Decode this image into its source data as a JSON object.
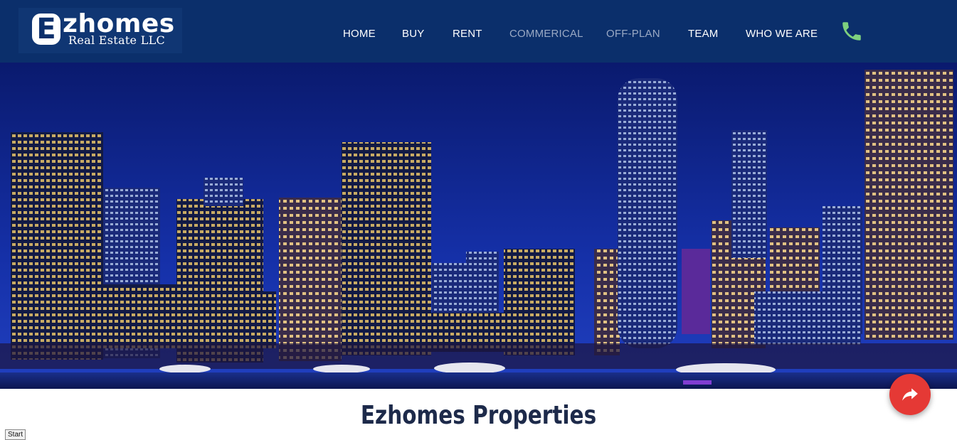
{
  "brand": {
    "mark": "E",
    "word": "zhomes",
    "subtitle": "Real Estate LLC"
  },
  "nav": [
    {
      "label": "HOME",
      "muted": false
    },
    {
      "label": "BUY",
      "muted": false
    },
    {
      "label": "RENT",
      "muted": false
    },
    {
      "label": "COMMERICAL",
      "muted": true
    },
    {
      "label": "OFF-PLAN",
      "muted": true
    },
    {
      "label": "TEAM",
      "muted": false
    },
    {
      "label": "WHO WE ARE",
      "muted": false
    }
  ],
  "header": {
    "phone_icon": "phone-icon",
    "background": "#0b2f6b",
    "phone_color": "#7ed07e"
  },
  "hero": {
    "image_subject": "city-skyline-night"
  },
  "section": {
    "title": "Ezhomes Properties"
  },
  "start_button": {
    "label": "Start"
  },
  "fab": {
    "icon": "share-icon",
    "color": "#e53935"
  }
}
